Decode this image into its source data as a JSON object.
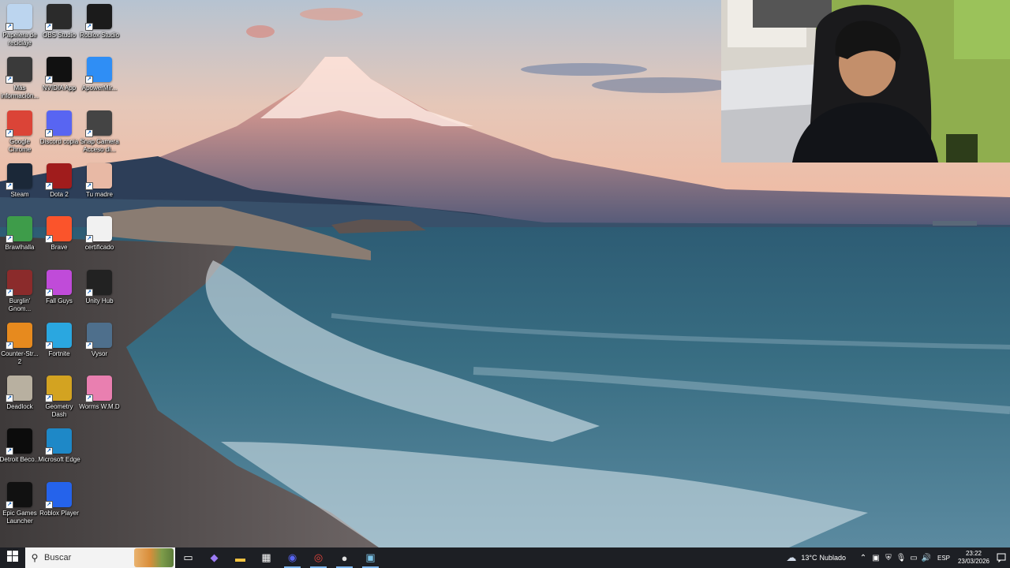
{
  "desktop": {
    "icons": [
      {
        "label": "Papelera de reciclaje",
        "icon": "recycle-bin-icon",
        "color": "#bcd5ef"
      },
      {
        "label": "OBS Studio",
        "icon": "obs-icon",
        "color": "#2b2b2b"
      },
      {
        "label": "Roblox Studio",
        "icon": "roblox-studio-icon",
        "color": "#1b1b1b"
      },
      {
        "label": "Más información...",
        "icon": "info-icon",
        "color": "#3a3a3a"
      },
      {
        "label": "NVIDIA App",
        "icon": "nvidia-icon",
        "color": "#111111"
      },
      {
        "label": "ApowerMir...",
        "icon": "apowermirror-icon",
        "color": "#2f8ef5"
      },
      {
        "label": "Google Chrome",
        "icon": "chrome-icon",
        "color": "#db4437"
      },
      {
        "label": "Discord copia",
        "icon": "discord-icon",
        "color": "#5865f2"
      },
      {
        "label": "Snap Camera Acceso di...",
        "icon": "snap-camera-icon",
        "color": "#444444"
      },
      {
        "label": "Steam",
        "icon": "steam-icon",
        "color": "#1b2838"
      },
      {
        "label": "Dota 2",
        "icon": "dota-icon",
        "color": "#a01c1c"
      },
      {
        "label": "Tu madre",
        "icon": "photo-icon",
        "color": "#e8b9a5"
      },
      {
        "label": "Brawlhalla",
        "icon": "brawlhalla-icon",
        "color": "#3e9c4a"
      },
      {
        "label": "Brave",
        "icon": "brave-icon",
        "color": "#fb542b"
      },
      {
        "label": "certificado",
        "icon": "document-icon",
        "color": "#f1f1f1"
      },
      {
        "label": "Burglin' Gnom...",
        "icon": "burglin-gnomes-icon",
        "color": "#8b2b2b"
      },
      {
        "label": "Fall Guys",
        "icon": "fall-guys-icon",
        "color": "#c04bd9"
      },
      {
        "label": "Unity Hub",
        "icon": "unity-icon",
        "color": "#222222"
      },
      {
        "label": "Counter-Str... 2",
        "icon": "counter-strike-icon",
        "color": "#e78a1e"
      },
      {
        "label": "Fortnite",
        "icon": "fortnite-icon",
        "color": "#2aa7e0"
      },
      {
        "label": "Vysor",
        "icon": "vysor-icon",
        "color": "#4e6f8c"
      },
      {
        "label": "Deadlock",
        "icon": "deadlock-icon",
        "color": "#b8b0a0"
      },
      {
        "label": "Geometry Dash",
        "icon": "geometry-dash-icon",
        "color": "#d3a321"
      },
      {
        "label": "Worms W.M.D",
        "icon": "worms-icon",
        "color": "#e97fb0"
      },
      {
        "label": "Detroit Beco...",
        "icon": "detroit-icon",
        "color": "#0c0c0c"
      },
      {
        "label": "Microsoft Edge",
        "icon": "edge-icon",
        "color": "#1e88c7"
      },
      {
        "label": "",
        "icon": "spacer",
        "color": "transparent"
      },
      {
        "label": "Epic Games Launcher",
        "icon": "epic-games-icon",
        "color": "#111111"
      },
      {
        "label": "Roblox Player",
        "icon": "roblox-icon",
        "color": "#2563eb"
      }
    ]
  },
  "taskbar": {
    "search_placeholder": "Buscar",
    "pinned": [
      {
        "name": "task-view",
        "icon": "task-view-icon"
      },
      {
        "name": "copilot",
        "icon": "copilot-icon"
      },
      {
        "name": "file-explorer",
        "icon": "folder-icon"
      },
      {
        "name": "microsoft-store",
        "icon": "store-icon"
      },
      {
        "name": "discord",
        "icon": "discord-icon"
      },
      {
        "name": "chrome",
        "icon": "chrome-icon"
      },
      {
        "name": "obs-studio",
        "icon": "obs-icon"
      },
      {
        "name": "photos",
        "icon": "photo-icon"
      }
    ],
    "weather": {
      "temp": "13°C",
      "condition": "Nublado"
    },
    "language": "ESP",
    "time": "23:22",
    "date": "23/03/2026"
  },
  "colors": {
    "taskbar_bg": "#1d1f24",
    "active_indicator": "#7fb7ee"
  }
}
